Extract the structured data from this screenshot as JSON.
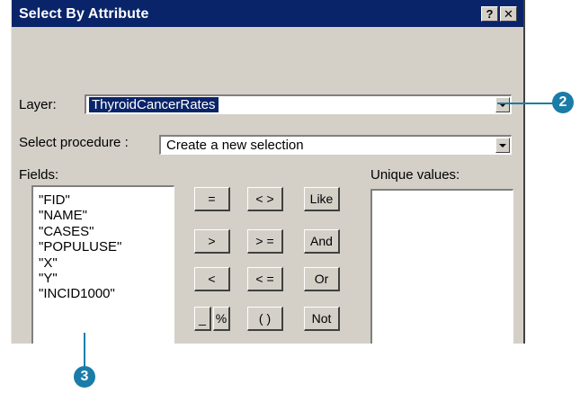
{
  "dialog": {
    "title": "Select By Attribute",
    "help_label": "?",
    "close_label": "✕"
  },
  "layer": {
    "label": "Layer:",
    "value": "ThyroidCancerRates"
  },
  "procedure": {
    "label": "Select procedure :",
    "value": "Create a new selection"
  },
  "fields": {
    "label": "Fields:",
    "items": [
      "\"FID\"",
      "\"NAME\"",
      "\"CASES\"",
      "\"POPULUSE\"",
      "\"X\"",
      "\"Y\"",
      "\"INCID1000\""
    ]
  },
  "operators": {
    "eq": "=",
    "neq": "< >",
    "like": "Like",
    "gt": ">",
    "gte": "> =",
    "and": "And",
    "lt": "<",
    "lte": "< =",
    "or": "Or",
    "underscore": "_",
    "percent": "%",
    "parens": "( )",
    "not": "Not"
  },
  "unique_values": {
    "label": "Unique values:"
  },
  "callouts": {
    "step2": "2",
    "step3": "3"
  },
  "colors": {
    "title_bar": "#0a246a",
    "dialog_face": "#d4d0c8",
    "callout": "#1a7ca8"
  }
}
